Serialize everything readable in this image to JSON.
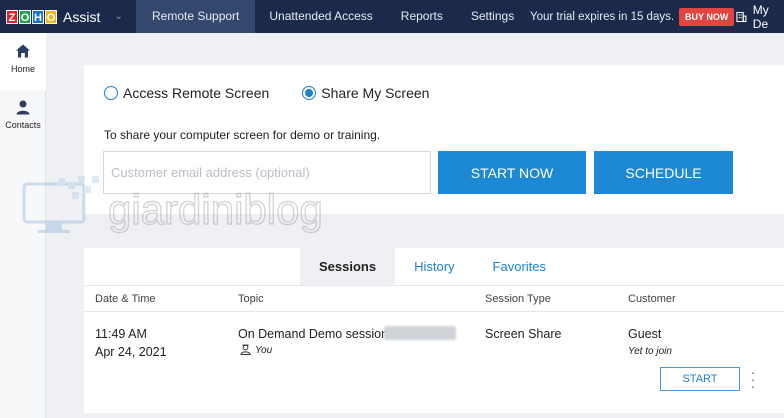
{
  "topbar": {
    "logo_letters": [
      "Z",
      "O",
      "H",
      "O"
    ],
    "product": "Assist",
    "nav": [
      {
        "label": "Remote Support",
        "active": true
      },
      {
        "label": "Unattended Access",
        "active": false
      },
      {
        "label": "Reports",
        "active": false
      },
      {
        "label": "Settings",
        "active": false
      }
    ],
    "trial_text": "Your trial expires in 15 days.",
    "buy_label": "BUY NOW",
    "account_label": "My De"
  },
  "sidebar": {
    "items": [
      {
        "label": "Home",
        "icon": "home-icon"
      },
      {
        "label": "Contacts",
        "icon": "contact-icon"
      }
    ]
  },
  "session_card": {
    "options": [
      {
        "label": "Access Remote Screen",
        "selected": false
      },
      {
        "label": "Share My Screen",
        "selected": true
      }
    ],
    "description": "To share your computer screen for demo or training.",
    "email_placeholder": "Customer email address (optional)",
    "start_label": "START NOW",
    "schedule_label": "SCHEDULE"
  },
  "sessions": {
    "tabs": [
      {
        "label": "Sessions",
        "active": true
      },
      {
        "label": "History",
        "active": false
      },
      {
        "label": "Favorites",
        "active": false
      }
    ],
    "columns": [
      "Date & Time",
      "Topic",
      "Session Type",
      "Customer"
    ],
    "rows": [
      {
        "time": "11:49 AM",
        "date": "Apr 24, 2021",
        "topic": "On Demand Demo session #",
        "owner": "You",
        "type": "Screen Share",
        "customer": "Guest",
        "customer_status": "Yet to join",
        "action": "START"
      }
    ]
  },
  "watermark_text": "giardiniblog",
  "colors": {
    "topbar": "#1b2a4a",
    "accent": "#1d88d4",
    "buy": "#e2443f"
  }
}
